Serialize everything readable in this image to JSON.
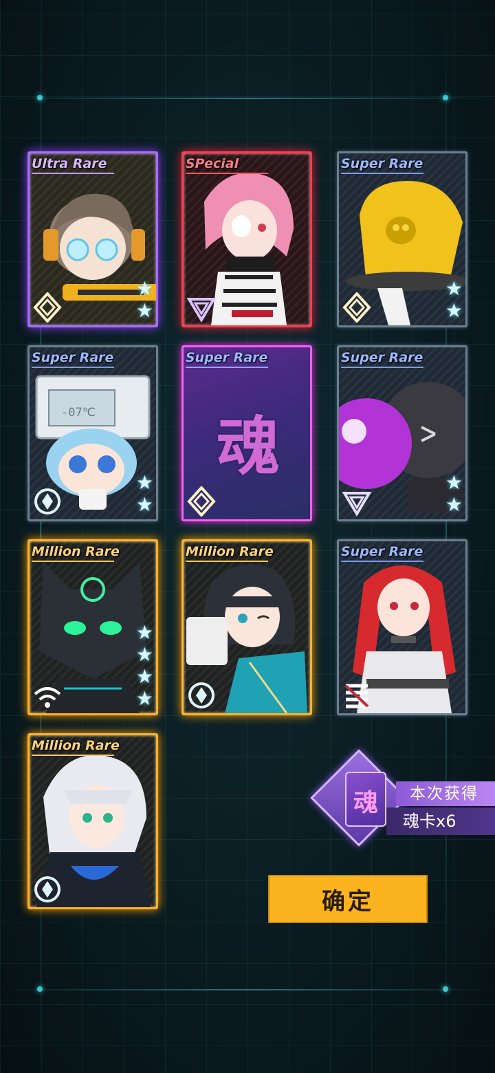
{
  "cards": [
    {
      "rarity": "Ultra Rare",
      "tier": "ur",
      "stars": 2,
      "emblem": "diamond-emblem-icon"
    },
    {
      "rarity": "SPecial",
      "tier": "sp",
      "stars": 0,
      "emblem": "triangle-emblem-icon"
    },
    {
      "rarity": "Super Rare",
      "tier": "sr",
      "stars": 2,
      "emblem": "diamond-emblem-icon"
    },
    {
      "rarity": "Super Rare",
      "tier": "sr",
      "stars": 2,
      "emblem": "target-emblem-icon"
    },
    {
      "rarity": "Super Rare",
      "tier": "soul",
      "stars": 0,
      "emblem": "diamond-emblem-icon",
      "glyph": "魂"
    },
    {
      "rarity": "Super Rare",
      "tier": "sr",
      "stars": 2,
      "emblem": "triangle-emblem-icon"
    },
    {
      "rarity": "Million Rare",
      "tier": "mr",
      "stars": 4,
      "emblem": "signal-emblem-icon"
    },
    {
      "rarity": "Million Rare",
      "tier": "mr",
      "stars": 0,
      "emblem": "target-emblem-icon"
    },
    {
      "rarity": "Super Rare",
      "tier": "sr",
      "stars": 0,
      "emblem": "stripes-emblem-icon"
    },
    {
      "rarity": "Million Rare",
      "tier": "mr",
      "stars": 0,
      "emblem": "target-emblem-icon"
    }
  ],
  "card3_display": "-07℃",
  "reward": {
    "icon_glyph": "魂",
    "title": "本次获得",
    "count": "魂卡x6"
  },
  "confirm_label": "确定",
  "colors": {
    "ultra_rare": "#a86cff",
    "special": "#ff3b4a",
    "super_rare": "#6c7f90",
    "million_rare": "#ffb327",
    "button": "#fbb420"
  }
}
